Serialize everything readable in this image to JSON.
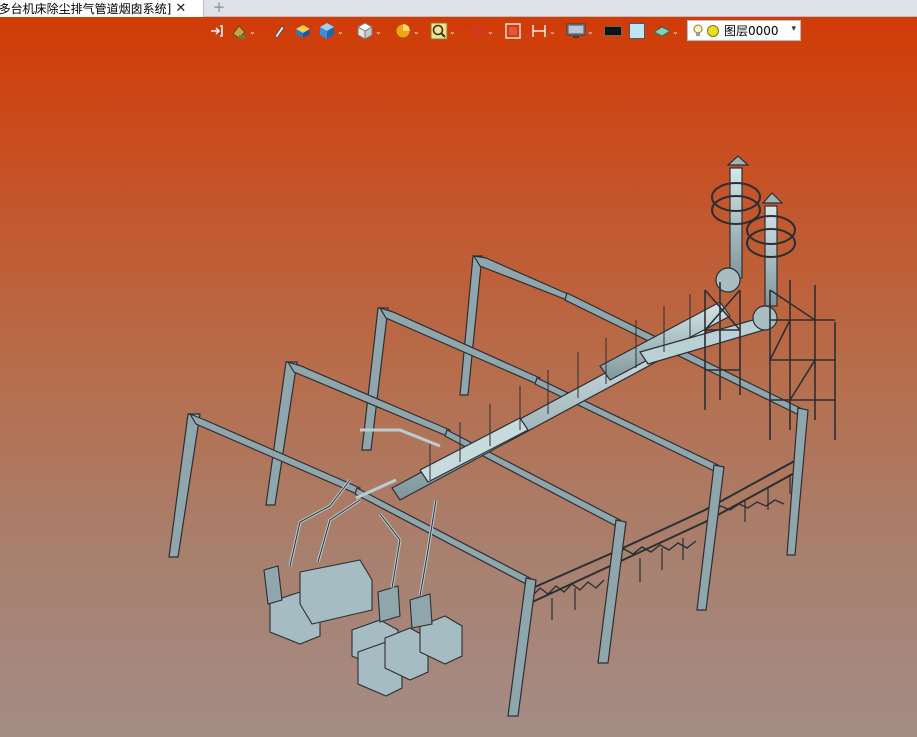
{
  "tab": {
    "title": "[多台机床除尘排气管道烟囱系统]",
    "close_glyph": "✕",
    "add_glyph": "+"
  },
  "toolbar": {
    "caret_glyph": "⌄",
    "layer_select": {
      "value": "图层0000",
      "arrow": "▾"
    },
    "colors": {
      "swatch_dark": "#111111",
      "swatch_light": "#bfe4f4"
    }
  },
  "icons": [
    "import-icon",
    "paint-bucket-icon",
    "pencil-icon",
    "box-solid-icon",
    "cube-view-icon",
    "white-cube-icon",
    "pie-render-icon",
    "zoom-icon",
    "orbit-icon",
    "fit-view-icon",
    "measure-icon",
    "monitor-icon",
    "black-swatch-icon",
    "light-swatch-icon",
    "layer-plane-icon",
    "lightbulb-icon",
    "layer-status-icon"
  ]
}
